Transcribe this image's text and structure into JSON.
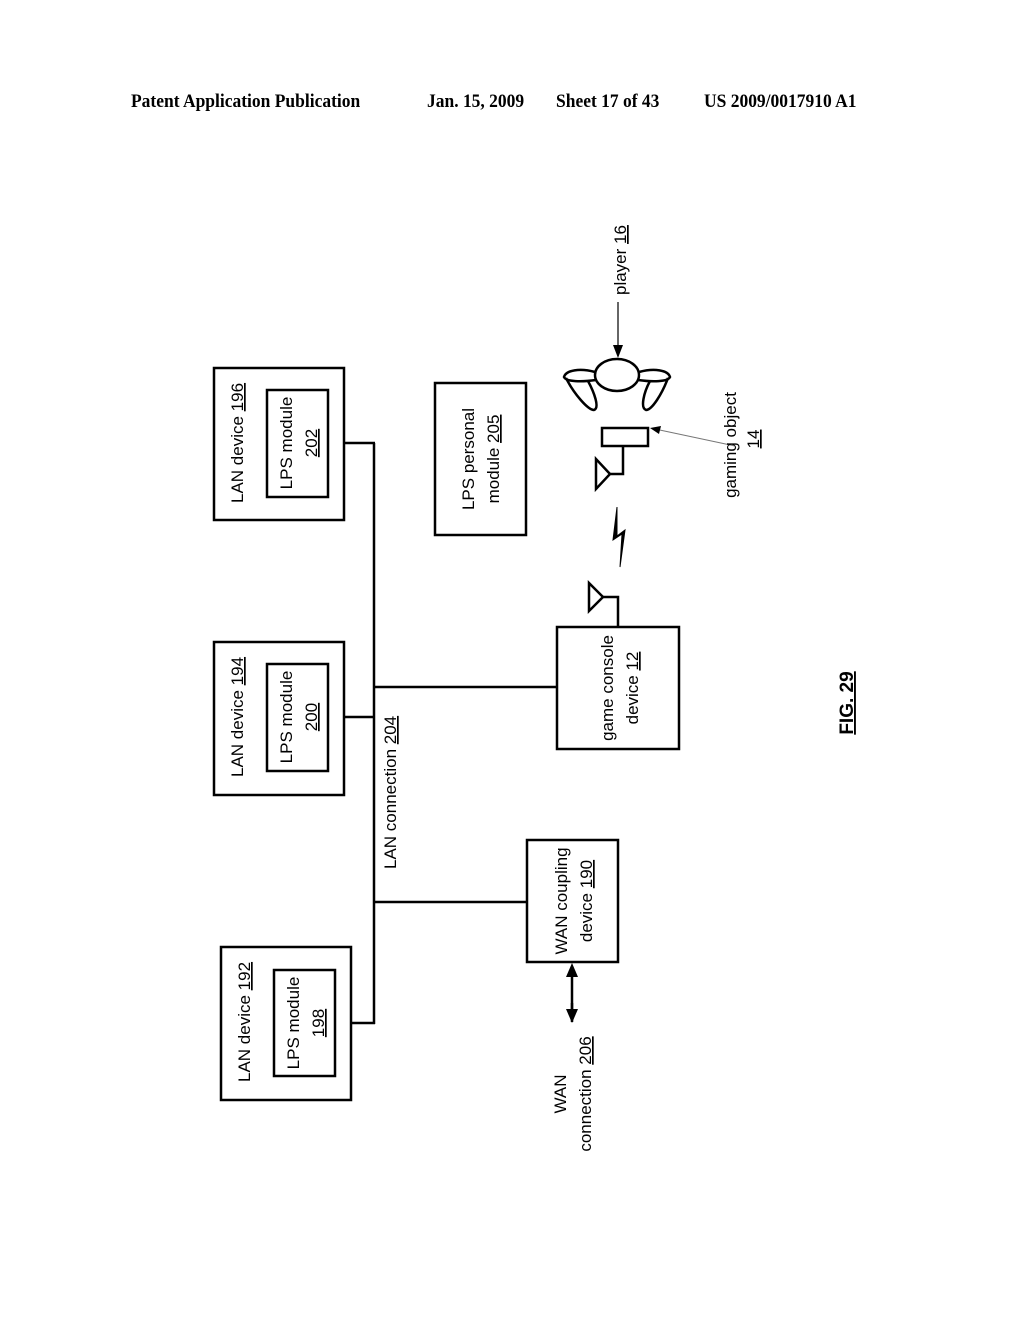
{
  "header": {
    "publication": "Patent Application Publication",
    "date": "Jan. 15, 2009",
    "sheet": "Sheet 17 of 43",
    "patent_number": "US 2009/0017910 A1"
  },
  "figure": {
    "label": "FIG. 29"
  },
  "nodes": {
    "lan_device_196": {
      "text": "LAN device ",
      "ref": "196"
    },
    "lps_module_202": {
      "text": "LPS module",
      "ref": "202"
    },
    "lan_device_194": {
      "text": "LAN device ",
      "ref": "194"
    },
    "lps_module_200": {
      "text": "LPS module",
      "ref": "200"
    },
    "lan_device_192": {
      "text": "LAN device ",
      "ref": "192"
    },
    "lps_module_198": {
      "text": "LPS module",
      "ref": "198"
    },
    "lps_personal_module": {
      "line1": "LPS personal",
      "line2": "module ",
      "ref": "205"
    },
    "game_console_device": {
      "line1": "game console",
      "line2": "device ",
      "ref": "12"
    },
    "wan_coupling_device": {
      "line1": "WAN coupling",
      "line2": "device ",
      "ref": "190"
    },
    "lan_connection": {
      "text": "LAN connection ",
      "ref": "204"
    },
    "wan_connection": {
      "line1": "WAN",
      "line2": "connection ",
      "ref": "206"
    },
    "player": {
      "text": "player ",
      "ref": "16"
    },
    "gaming_object": {
      "line1": "gaming object",
      "ref": "14"
    }
  }
}
